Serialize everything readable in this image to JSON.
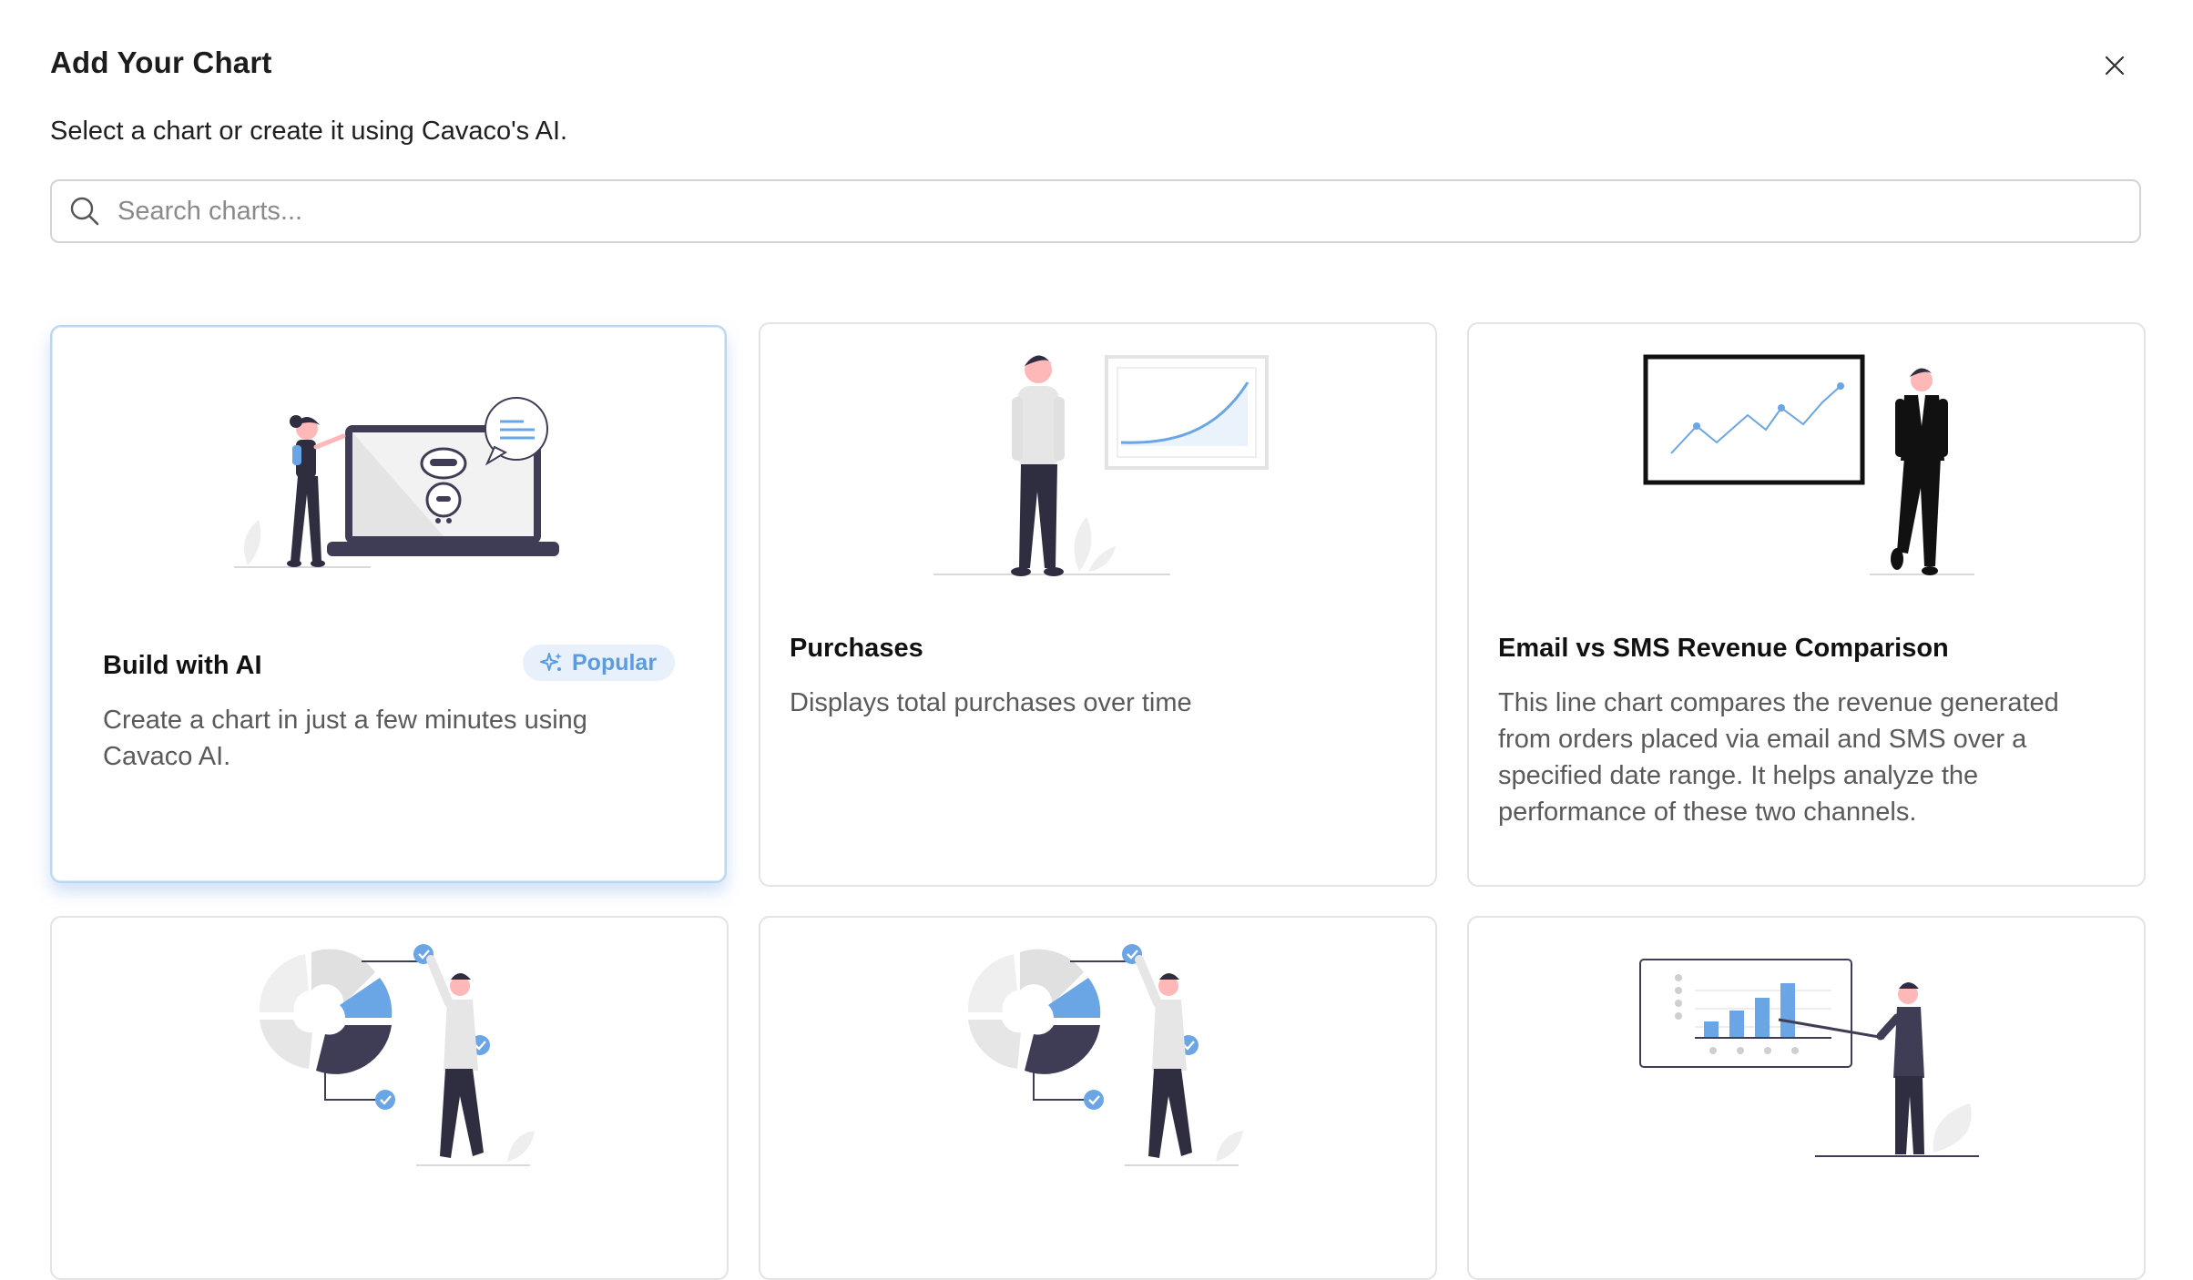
{
  "header": {
    "title": "Add Your Chart",
    "subtitle": "Select a chart or create it using Cavaco's AI."
  },
  "search": {
    "placeholder": "Search charts..."
  },
  "cards": [
    {
      "title": "Build with AI",
      "badge": "Popular",
      "description_lines": [
        "Create a chart in just a few minutes using",
        "Cavaco AI."
      ]
    },
    {
      "title": "Purchases",
      "description_lines": [
        "Displays total purchases over time"
      ]
    },
    {
      "title": "Email vs SMS Revenue Comparison",
      "description_lines": [
        "This line chart compares the revenue generated",
        "from orders placed via email and SMS over a",
        "specified date range. It helps analyze the",
        "performance of these two channels."
      ]
    }
  ],
  "colors": {
    "accent": "#5b9be0",
    "accent_light": "#e8f1fb",
    "dark_figure": "#2f2e41",
    "border": "#e3e3e3"
  }
}
